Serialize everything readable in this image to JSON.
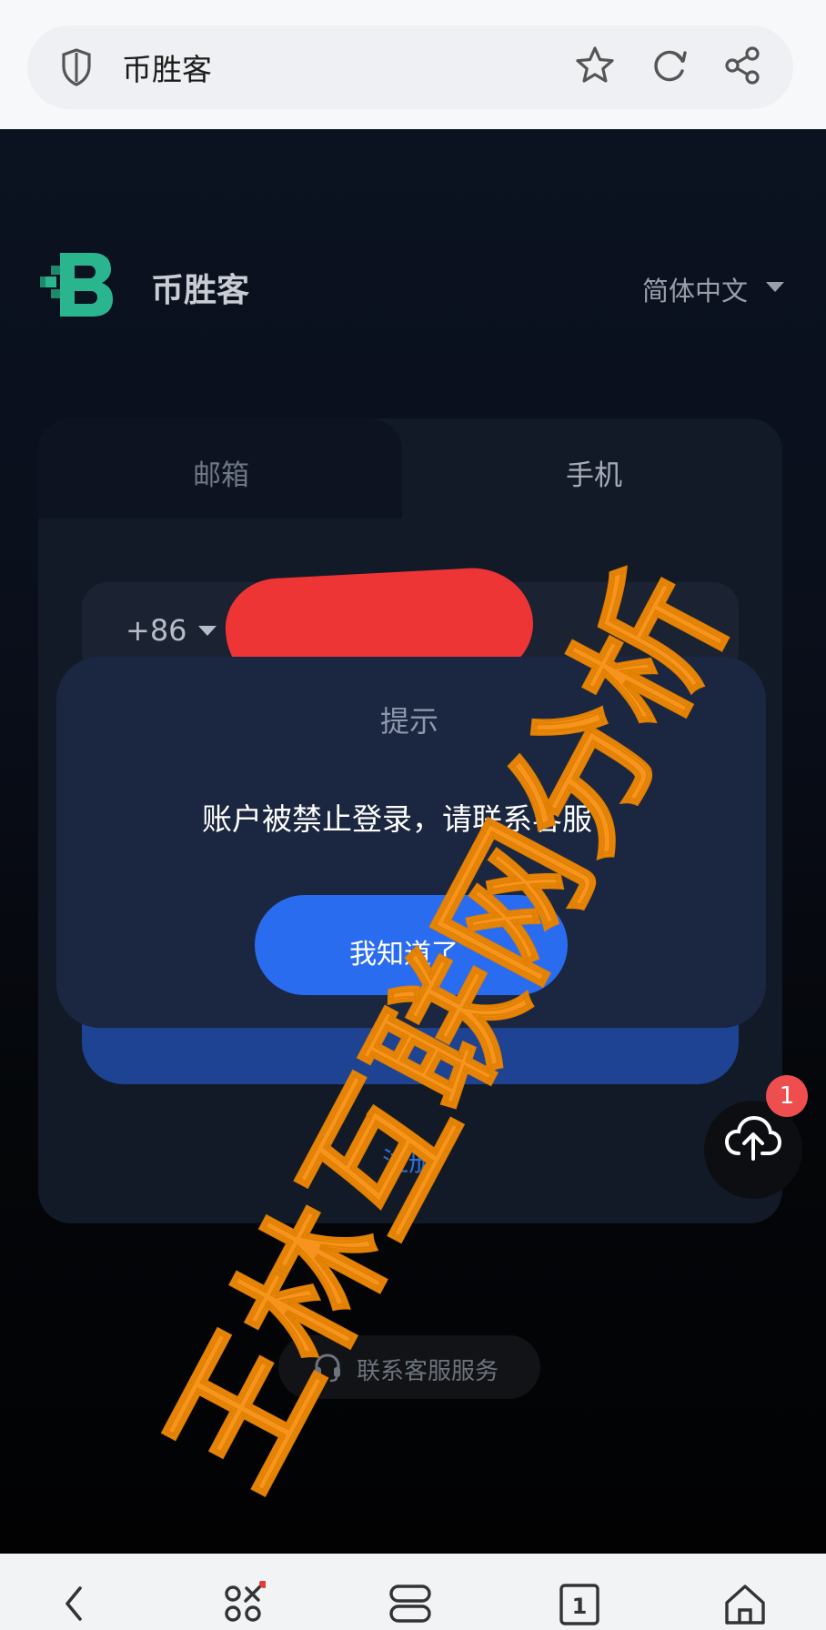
{
  "browser": {
    "title": "币胜客",
    "icons": [
      "shield-icon",
      "star-icon",
      "reload-icon",
      "share-icon"
    ]
  },
  "header": {
    "site_name": "币胜客",
    "language": "简体中文"
  },
  "tabs": {
    "email": "邮箱",
    "phone": "手机"
  },
  "form": {
    "country_code": "+86",
    "register": "注册"
  },
  "dialog": {
    "title": "提示",
    "message": "账户被禁止登录，请联系客服",
    "button": "我知道了"
  },
  "upload": {
    "badge": "1"
  },
  "support": {
    "label": "联系客服服务"
  },
  "watermark": {
    "text": "王林互联网分析"
  },
  "nav": {
    "items": [
      "back-icon",
      "apps-icon",
      "tabs-icon",
      "tab-count-icon",
      "home-icon"
    ],
    "tab_count": "1"
  },
  "colors": {
    "accent": "#2a6cf0",
    "brand_green": "#2bb58f",
    "redaction": "#ee3535",
    "watermark": "#f7941d",
    "badge": "#ee4e4e"
  }
}
